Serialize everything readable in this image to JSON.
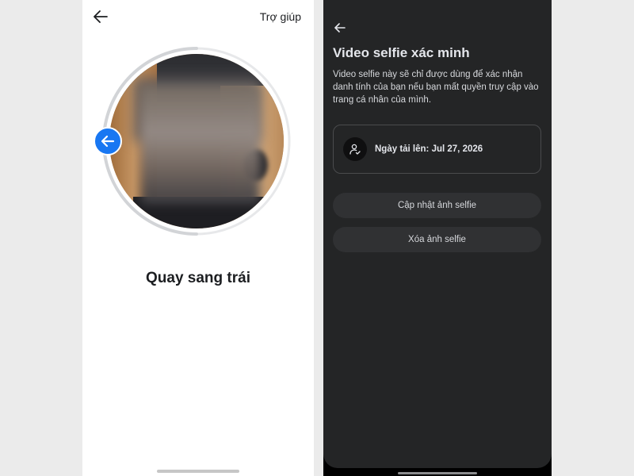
{
  "left_screen": {
    "help_label": "Trợ giúp",
    "instruction": "Quay sang trái",
    "icons": {
      "back": "back-arrow-icon",
      "direction": "arrow-left-icon"
    },
    "colors": {
      "accent": "#1877f2",
      "background": "#ffffff",
      "text": "#1c1e21"
    }
  },
  "right_screen": {
    "title": "Video selfie xác minh",
    "description": "Video selfie này sẽ chỉ được dùng để xác nhận danh tính của bạn nếu bạn mất quyền truy cập vào trang cá nhân của mình.",
    "upload_info": "Ngày tải lên: Jul 27, 2026",
    "update_button": "Cập nhật ảnh selfie",
    "delete_button": "Xóa ảnh selfie",
    "icons": {
      "back": "back-arrow-icon",
      "verified_user": "user-check-icon"
    },
    "colors": {
      "background": "#242526",
      "button": "#303133",
      "text": "#e4e6eb"
    }
  }
}
